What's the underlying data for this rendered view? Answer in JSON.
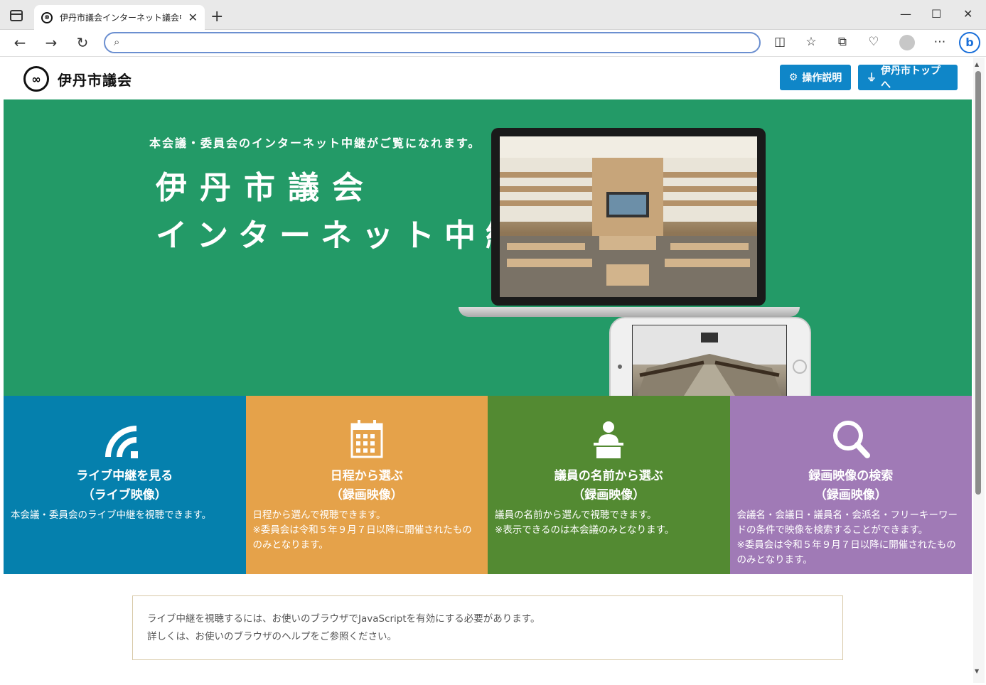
{
  "browser": {
    "tab_title": "伊丹市議会インターネット議会中継",
    "address": "",
    "minimize": "—",
    "maximize": "☐",
    "close": "✕",
    "new_tab": "+"
  },
  "header": {
    "logo_text": "伊丹市議会",
    "manual_button": "操作説明",
    "top_button": "伊丹市トップへ"
  },
  "hero": {
    "subtitle": "本会議・委員会のインターネット中継がご覧になれます。",
    "title_line1": "伊丹市議会",
    "title_line2": "インターネット中継"
  },
  "tiles": [
    {
      "title1": "ライブ中継を見る",
      "title2": "（ライブ映像）",
      "desc": "本会議・委員会のライブ中継を視聴できます。",
      "color": "#0580ad",
      "icon": "live-signal-icon"
    },
    {
      "title1": "日程から選ぶ",
      "title2": "（録画映像）",
      "desc": "日程から選んで視聴できます。\n※委員会は令和５年９月７日以降に開催されたもののみとなります。",
      "color": "#e5a24a",
      "icon": "calendar-icon"
    },
    {
      "title1": "議員の名前から選ぶ",
      "title2": "（録画映像）",
      "desc": "議員の名前から選んで視聴できます。\n※表示できるのは本会議のみとなります。",
      "color": "#538a32",
      "icon": "speaker-podium-icon"
    },
    {
      "title1": "録画映像の検索",
      "title2": "（録画映像）",
      "desc": "会議名・会議日・議員名・会派名・フリーキーワードの条件で映像を検索することができます。\n※委員会は令和５年９月７日以降に開催されたもののみとなります。",
      "color": "#a07ab6",
      "icon": "search-magnifier-icon"
    }
  ],
  "notice": {
    "line1": "ライブ中継を視聴するには、お使いのブラウザでJavaScriptを有効にする必要があります。",
    "line2": "詳しくは、お使いのブラウザのヘルプをご参照ください。"
  }
}
